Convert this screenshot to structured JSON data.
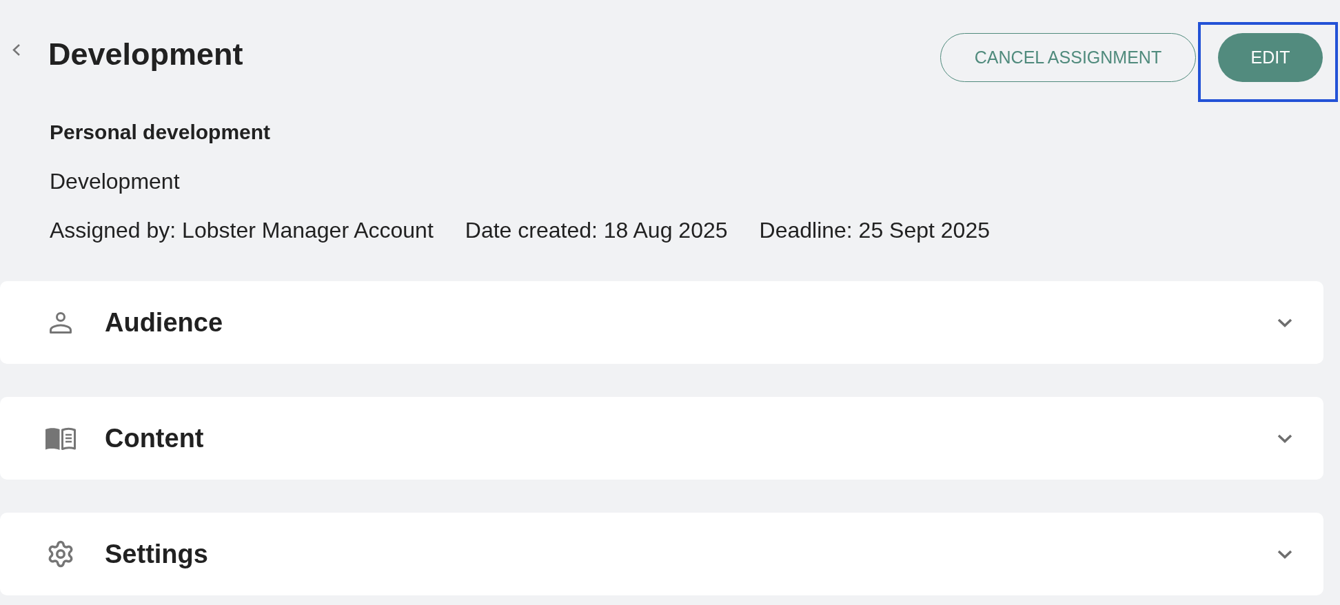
{
  "header": {
    "title": "Development",
    "buttons": [
      {
        "label": "CANCEL ASSIGNMENT",
        "kind": "outline",
        "highlighted": false
      },
      {
        "label": "EDIT",
        "kind": "filled",
        "highlighted": true
      }
    ]
  },
  "details": {
    "category": "Personal development",
    "name": "Development",
    "meta": [
      "Assigned by: Lobster Manager Account",
      "Date created: 18 Aug 2025",
      "Deadline: 25 Sept 2025"
    ]
  },
  "sections": [
    {
      "title": "Audience",
      "expanded": false
    },
    {
      "title": "Content",
      "expanded": false
    },
    {
      "title": "Settings",
      "expanded": false
    }
  ]
}
